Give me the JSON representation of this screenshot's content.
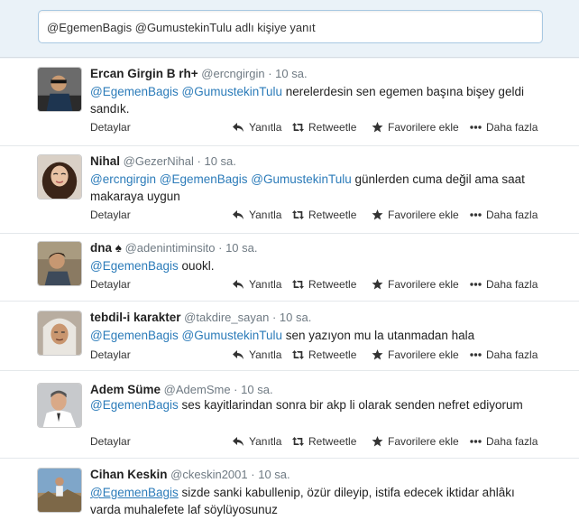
{
  "reply_box": {
    "value": "@EgemenBagis @GumustekinTulu adlı kişiye yanıt"
  },
  "actions": {
    "details": "Detaylar",
    "reply": "Yanıtla",
    "retweet": "Retweetle",
    "favorite": "Favorilere ekle",
    "more": "Daha fazla"
  },
  "tweets": [
    {
      "name": "Ercan Girgin B rh+",
      "username": "@ercngirgin",
      "time": "10 sa.",
      "text_parts": [
        "@EgemenBagis",
        " ",
        "@GumustekinTulu",
        " nerelerdesin sen egemen başına bişey geldi sandık."
      ]
    },
    {
      "name": "Nihal",
      "username": "@GezerNihal",
      "time": "10 sa.",
      "text_parts": [
        "@ercngirgin",
        " ",
        "@EgemenBagis",
        " ",
        "@GumustekinTulu",
        " günlerden cuma değil ama saat makaraya uygun"
      ]
    },
    {
      "name": "dna ♠",
      "username": "@adenintiminsito",
      "time": "10 sa.",
      "text_parts": [
        "@EgemenBagis",
        " ouokl."
      ]
    },
    {
      "name": "tebdil-i karakter",
      "username": "@takdire_sayan",
      "time": "10 sa.",
      "text_parts": [
        "@EgemenBagis",
        " ",
        "@GumustekinTulu",
        " sen yazıyon mu la utanmadan hala"
      ]
    },
    {
      "name": "Adem Süme",
      "username": "@AdemSme",
      "time": "10 sa.",
      "text_parts": [
        "@EgemenBagis",
        " ses kayitlarindan sonra bir akp li olarak senden nefret ediyorum"
      ]
    },
    {
      "name": "Cihan Keskin",
      "username": "@ckeskin2001",
      "time": "10 sa.",
      "text_parts": [
        "@EgemenBagis",
        " sizde sanki kabullenip, özür dileyip, istifa edecek iktidar ahlâkı varda muhalefete laf söylüyosunuz"
      ]
    }
  ]
}
